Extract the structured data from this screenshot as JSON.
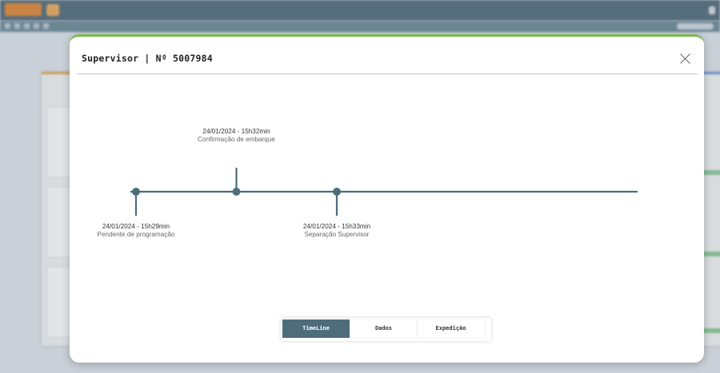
{
  "modal": {
    "title": "Supervisor | Nº 5007984",
    "accent_color": "#7cba4a"
  },
  "timeline": {
    "line_color": "#4d6d7d",
    "events": [
      {
        "date": "24/01/2024 - 15h29min",
        "label": "Pendente de programação",
        "side": "below"
      },
      {
        "date": "24/01/2024 - 15h32min",
        "label": "Confirmação de embarque",
        "side": "above"
      },
      {
        "date": "24/01/2024 - 15h33min",
        "label": "Separação Supervisor",
        "side": "below"
      }
    ]
  },
  "tabs": [
    {
      "label": "TimeLine",
      "active": true
    },
    {
      "label": "Dados",
      "active": false
    },
    {
      "label": "Expedição",
      "active": false
    }
  ],
  "icons": {
    "close": "close-icon"
  }
}
